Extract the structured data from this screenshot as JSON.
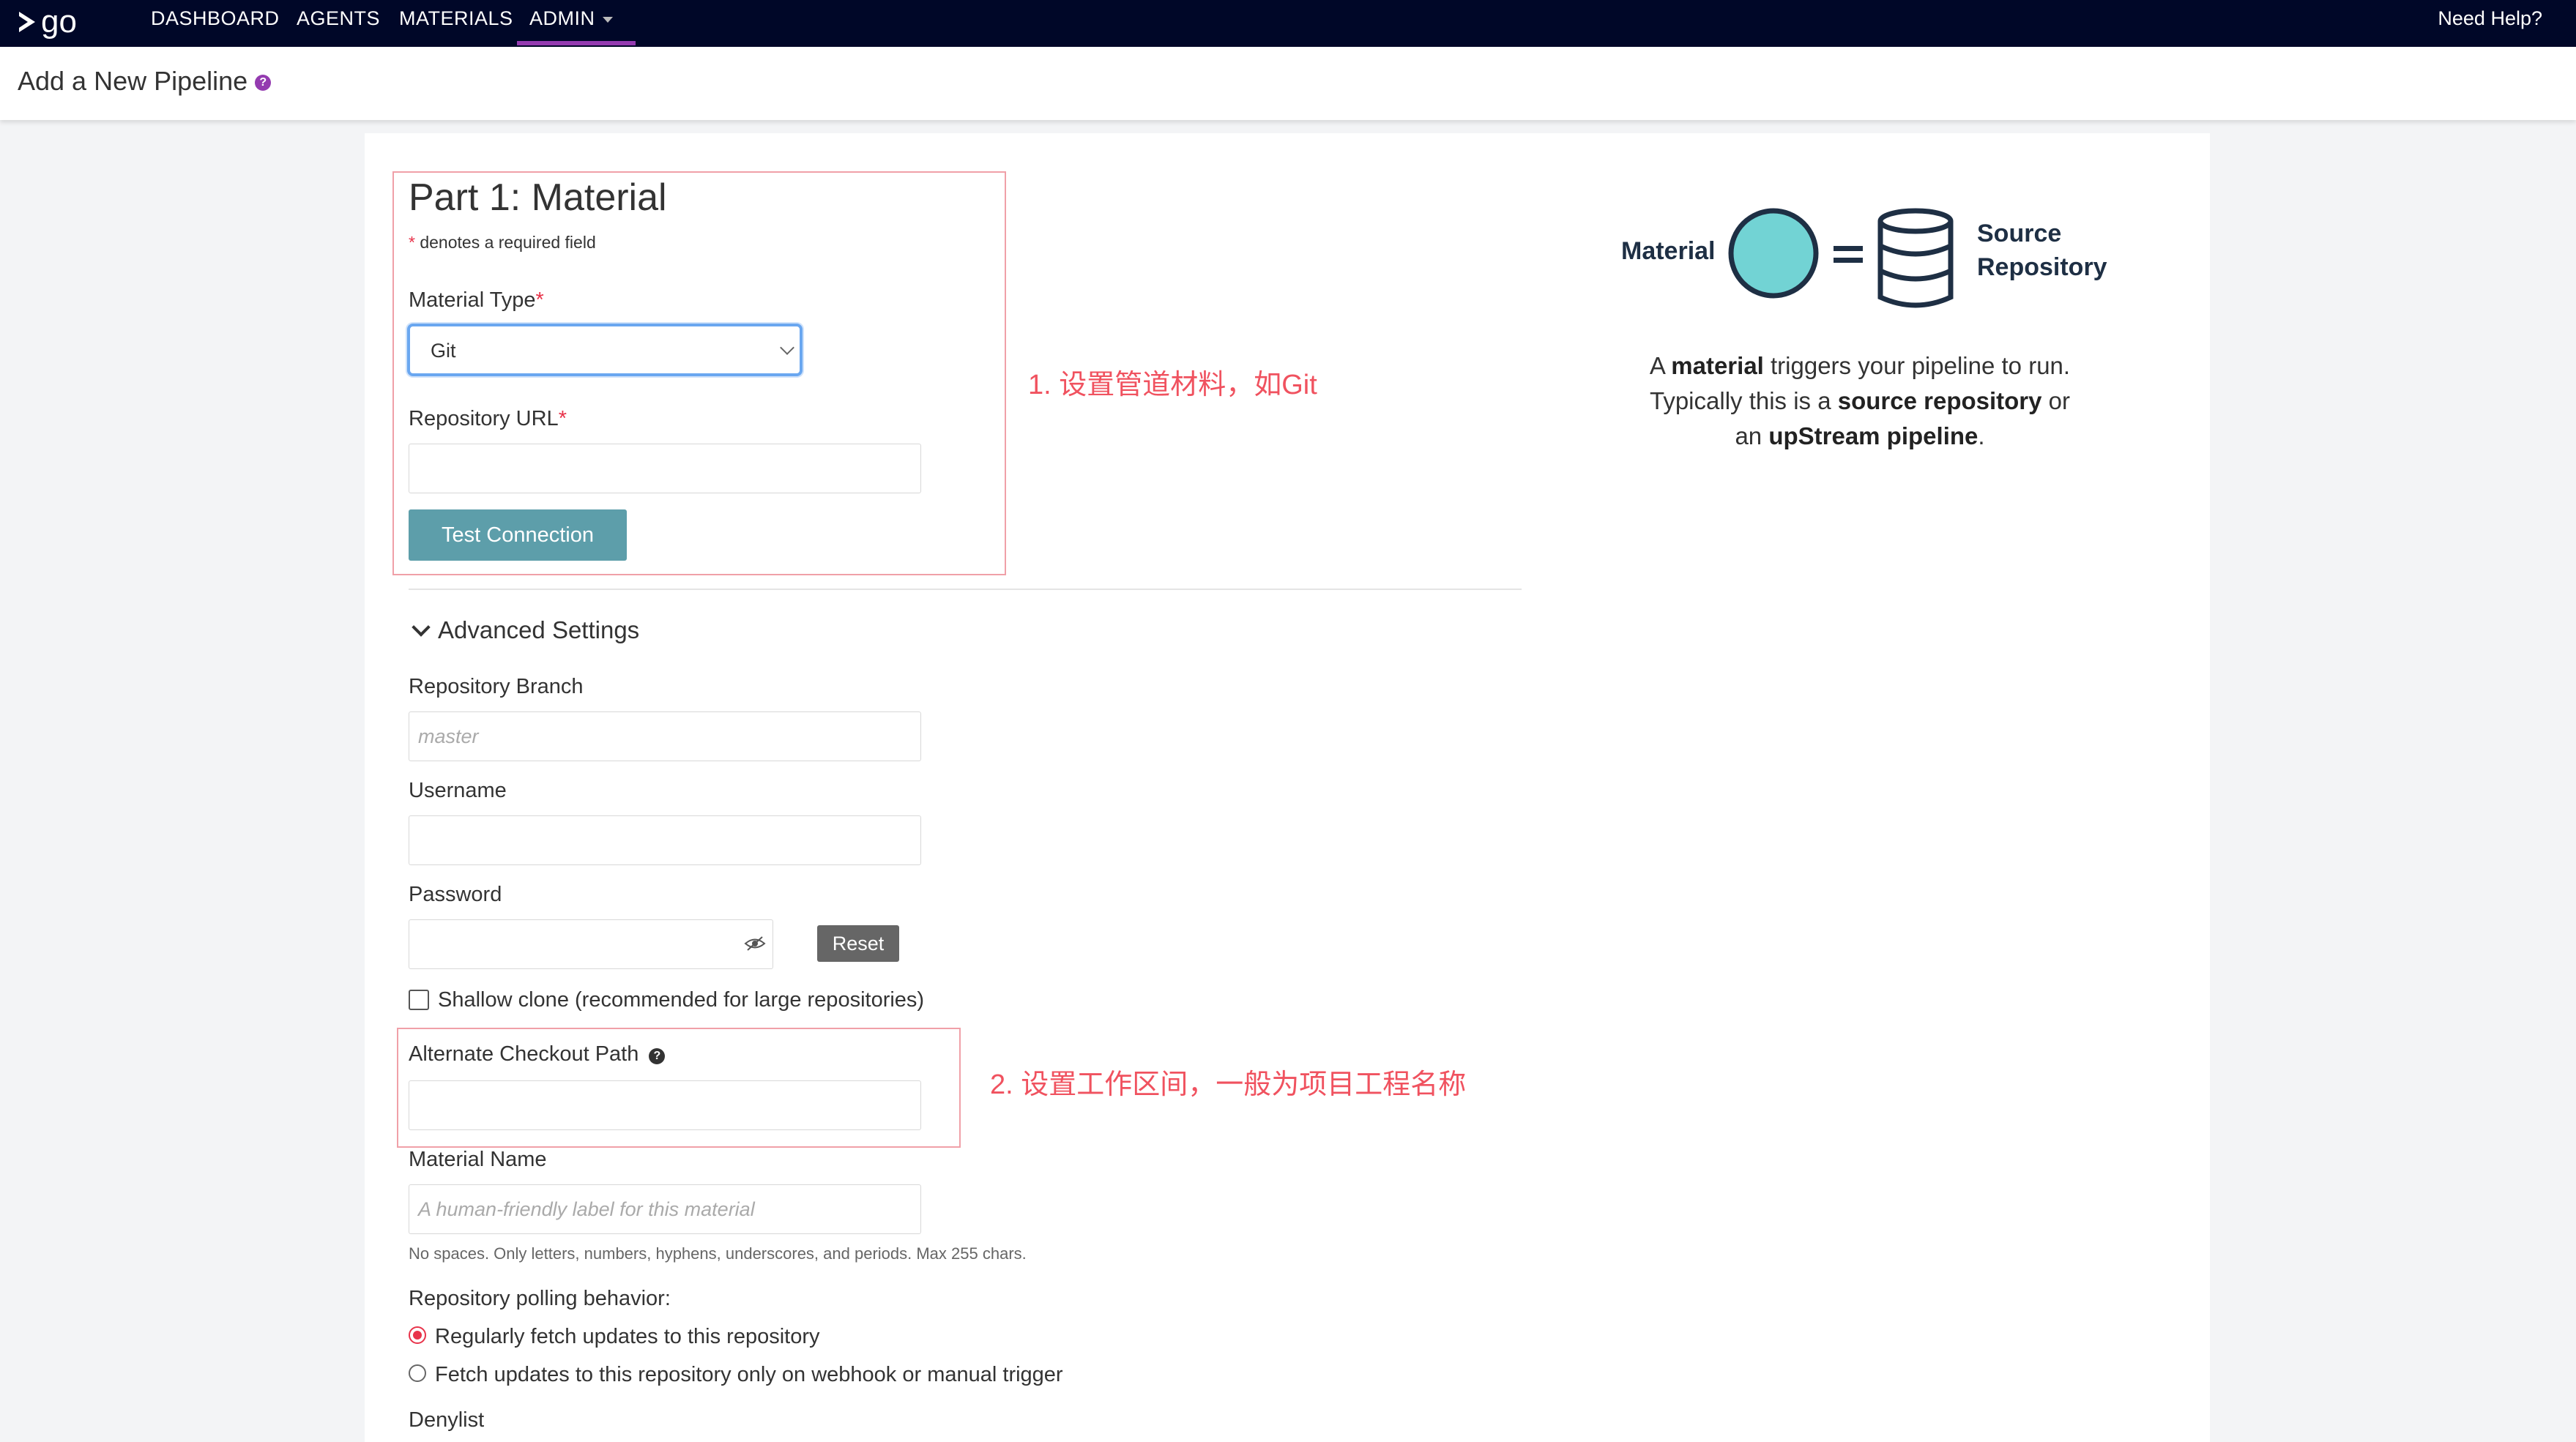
{
  "topnav": {
    "logo": "go",
    "items": [
      "DASHBOARD",
      "AGENTS",
      "MATERIALS",
      "ADMIN"
    ],
    "help": "Need Help?"
  },
  "header": {
    "title": "Add a New Pipeline"
  },
  "form": {
    "part_title": "Part 1: Material",
    "required_star": "*",
    "required_note": "denotes a required field",
    "material_type_label": "Material Type",
    "material_type_value": "Git",
    "repo_url_label": "Repository URL",
    "repo_url_value": "",
    "test_connection": "Test Connection",
    "advanced_title": "Advanced Settings",
    "branch_label": "Repository Branch",
    "branch_placeholder": "master",
    "username_label": "Username",
    "password_label": "Password",
    "reset": "Reset",
    "shallow_clone": "Shallow clone (recommended for large repositories)",
    "checkout_path_label": "Alternate Checkout Path",
    "material_name_label": "Material Name",
    "material_name_placeholder": "A human-friendly label for this material",
    "name_hint": "No spaces. Only letters, numbers, hyphens, underscores, and periods. Max 255 chars.",
    "polling_label": "Repository polling behavior:",
    "polling_option_1": "Regularly fetch updates to this repository",
    "polling_option_2": "Fetch updates to this repository only on webhook or manual trigger",
    "polling_selected": "Regularly fetch updates to this repository",
    "denylist_label": "Denylist"
  },
  "annotations": {
    "a1": "1. 设置管道材料，如Git",
    "a2": "2. 设置工作区间，一般为项目工程名称"
  },
  "diagram": {
    "left_label": "Material",
    "right_label_1": "Source",
    "right_label_2": "Repository",
    "circle_color": "#72d3d4",
    "stroke_color": "#1e2f44"
  },
  "description": {
    "p1": "A ",
    "b1": "material",
    "p2": " triggers your pipeline to run.",
    "p3": "Typically this is a ",
    "b2": "source repository",
    "p4": " or",
    "p5": "an ",
    "b3": "upStream pipeline",
    "p6": "."
  },
  "colors": {
    "nav_bg": "#000728",
    "accent": "#943bb0",
    "button": "#5d9eaa",
    "required": "#e8334a"
  }
}
